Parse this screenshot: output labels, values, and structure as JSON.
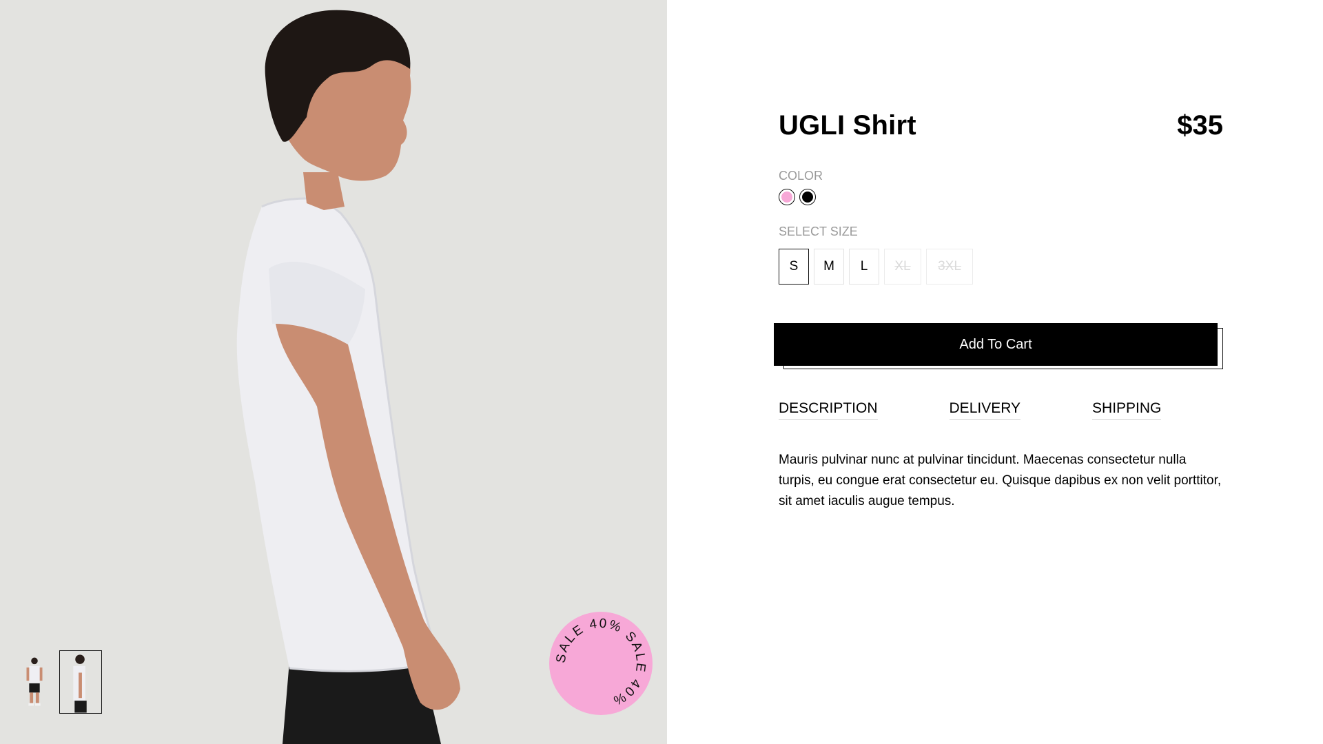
{
  "product": {
    "title": "UGLI Shirt",
    "price": "$35"
  },
  "color": {
    "label": "COLOR",
    "options": [
      {
        "name": "pink",
        "hex": "#f7a8d7",
        "selected": false
      },
      {
        "name": "black",
        "hex": "#000000",
        "selected": true
      }
    ]
  },
  "size": {
    "label": "SELECT SIZE",
    "options": [
      {
        "label": "S",
        "selected": true,
        "available": true
      },
      {
        "label": "M",
        "selected": false,
        "available": true
      },
      {
        "label": "L",
        "selected": false,
        "available": true
      },
      {
        "label": "XL",
        "selected": false,
        "available": false
      },
      {
        "label": "3XL",
        "selected": false,
        "available": false
      }
    ]
  },
  "cart": {
    "button_label": "Add To Cart"
  },
  "tabs": [
    {
      "label": "DESCRIPTION"
    },
    {
      "label": "DELIVERY"
    },
    {
      "label": "SHIPPING"
    }
  ],
  "description": "Mauris pulvinar nunc at pulvinar tincidunt. Maecenas consectetur nulla turpis, eu congue erat consectetur eu. Quisque dapibus ex non velit porttitor, sit amet iaculis augue tempus.",
  "sale_badge": {
    "text": "SALE 40% SALE 40% ",
    "color": "#f7a8d7"
  },
  "gallery": {
    "thumbnails": [
      {
        "view": "front",
        "active": false
      },
      {
        "view": "side",
        "active": true
      }
    ],
    "background": "#e3e3e0"
  }
}
